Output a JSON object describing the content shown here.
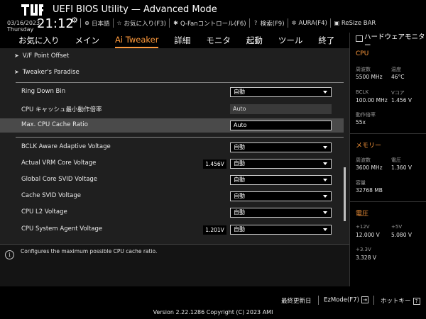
{
  "header": {
    "title": "UEFI BIOS Utility — Advanced Mode",
    "date": "03/16/2023",
    "weekday": "Thursday",
    "time": "21:12",
    "tools": [
      {
        "icon": "globe-icon",
        "label": "日本語"
      },
      {
        "icon": "star-icon",
        "label": "お気に入り(F3)"
      },
      {
        "icon": "fan-icon",
        "label": "Q-Fanコントロール(F6)"
      },
      {
        "icon": "help-icon",
        "label": "検索(F9)"
      },
      {
        "icon": "aura-icon",
        "label": "AURA(F4)"
      },
      {
        "icon": "resize-bar-icon",
        "label": "ReSize BAR"
      }
    ]
  },
  "tabs": [
    "お気に入り",
    "メイン",
    "Ai Tweaker",
    "詳細",
    "モニタ",
    "起動",
    "ツール",
    "終了"
  ],
  "active_tab": "Ai Tweaker",
  "main": {
    "links": [
      "V/F Point Offset",
      "Tweaker's Paradise"
    ],
    "settings": [
      {
        "label": "Ring Down Bin",
        "value": "自動",
        "control": "dropdown"
      },
      {
        "label": "CPU キャッシュ最小動作倍率",
        "value": "Auto",
        "control": "readonly"
      },
      {
        "label": "Max. CPU Cache Ratio",
        "value": "Auto",
        "control": "edit"
      },
      {
        "label": "BCLK Aware Adaptive Voltage",
        "value": "自動",
        "control": "dropdown"
      },
      {
        "label": "Actual VRM Core Voltage",
        "value": "自動",
        "control": "dropdown",
        "reading": "1.456V"
      },
      {
        "label": "Global Core SVID Voltage",
        "value": "自動",
        "control": "dropdown"
      },
      {
        "label": "Cache SVID Voltage",
        "value": "自動",
        "control": "dropdown"
      },
      {
        "label": "CPU L2 Voltage",
        "value": "自動",
        "control": "dropdown"
      },
      {
        "label": "CPU System Agent Voltage",
        "value": "自動",
        "control": "dropdown",
        "reading": "1.201V"
      }
    ]
  },
  "help": {
    "text": "Configures the maximum possible CPU cache ratio."
  },
  "hw": {
    "title": "ハードウェアモニター",
    "cpu": {
      "heading": "CPU",
      "freq_label": "周波数",
      "freq": "5500 MHz",
      "temp_label": "温度",
      "temp": "46°C",
      "bclk_label": "BCLK",
      "bclk": "100.00 MHz",
      "vcore_label": "Vコア",
      "vcore": "1.456 V",
      "ratio_label": "動作倍率",
      "ratio": "55x"
    },
    "memory": {
      "heading": "メモリー",
      "freq_label": "周波数",
      "freq": "3600 MHz",
      "volt_label": "電圧",
      "volt": "1.360 V",
      "cap_label": "容量",
      "cap": "32768 MB"
    },
    "voltage": {
      "heading": "電圧",
      "v12_label": "+12V",
      "v12": "12.000 V",
      "v5_label": "+5V",
      "v5": "5.080 V",
      "v33_label": "+3.3V",
      "v33": "3.328 V"
    }
  },
  "footer": {
    "last_modified": "最終更新日",
    "ezmode": "EzMode(F7)",
    "hotkeys": "ホットキー",
    "hotkey_symbol": "?",
    "copyright": "Version 2.22.1286 Copyright (C) 2023 AMI"
  },
  "colors": {
    "accent": "#ff9a3c",
    "panel": "#1f1f1f",
    "highlight": "#4a4a4a",
    "background": "#000000"
  }
}
